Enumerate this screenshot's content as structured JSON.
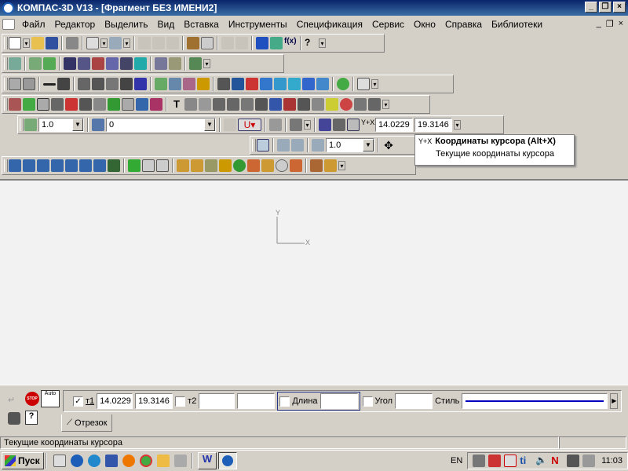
{
  "window": {
    "title": "КОМПАС-3D V13 - [Фрагмент БЕЗ ИМЕНИ2]"
  },
  "menu": [
    "Файл",
    "Редактор",
    "Выделить",
    "Вид",
    "Вставка",
    "Инструменты",
    "Спецификация",
    "Сервис",
    "Окно",
    "Справка",
    "Библиотеки"
  ],
  "toolbar4": {
    "scale": "1.0",
    "layer": "0",
    "cursor_x": "14.0229",
    "cursor_y": "19.3146"
  },
  "toolbar5": {
    "zoom": "1.0"
  },
  "tooltip": {
    "title": "Координаты курсора (Alt+X)",
    "description": "Текущие координаты курсора"
  },
  "canvas": {
    "axis_x": "X",
    "axis_y": "Y"
  },
  "props": {
    "auto_label": "Auto",
    "stop_label": "STOP",
    "t1_label": "т1",
    "t1_x": "14.0229",
    "t1_y": "19.3146",
    "t2_label": "т2",
    "length_label": "Длина",
    "angle_label": "Угол",
    "style_label": "Стиль",
    "tab_label": "Отрезок"
  },
  "status": {
    "text": "Текущие координаты курсора"
  },
  "taskbar": {
    "start": "Пуск",
    "lang": "EN",
    "time": "11:03"
  },
  "colors": {
    "title_bar": "#0a246a",
    "style_line": "#0000c0"
  }
}
